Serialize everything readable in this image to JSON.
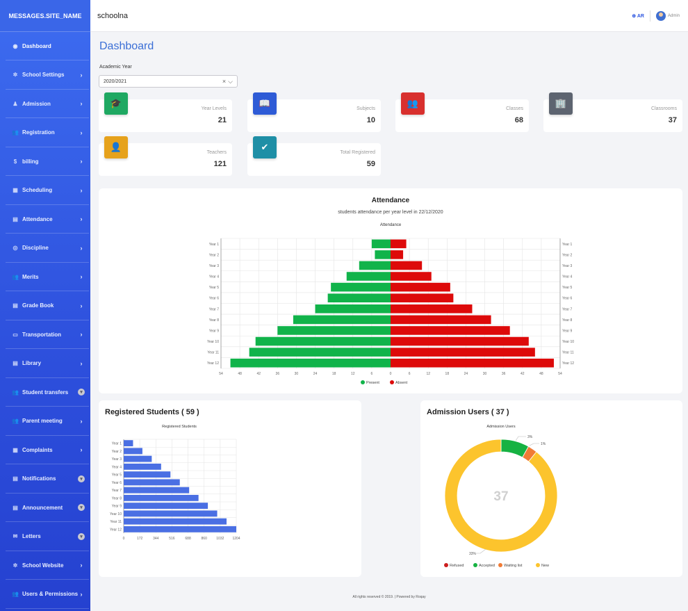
{
  "brand": "MESSAGES.SITE_NAME",
  "site_title": "schoolna",
  "header": {
    "lang": "AR",
    "user": "Admin"
  },
  "sidebar": {
    "items": [
      {
        "label": "Dashboard",
        "icon": "dashboard-icon",
        "chevron": "",
        "badge": "",
        "active": true
      },
      {
        "label": "School Settings",
        "icon": "gear-icon",
        "chevron": "›",
        "badge": ""
      },
      {
        "label": "Admission",
        "icon": "user-icon",
        "chevron": "›",
        "badge": ""
      },
      {
        "label": "Registration",
        "icon": "users-icon",
        "chevron": "›",
        "badge": ""
      },
      {
        "label": "billing",
        "icon": "dollar-icon",
        "chevron": "›",
        "badge": ""
      },
      {
        "label": "Scheduling",
        "icon": "table-icon",
        "chevron": "›",
        "badge": ""
      },
      {
        "label": "Attendance",
        "icon": "list-icon",
        "chevron": "›",
        "badge": ""
      },
      {
        "label": "Discipline",
        "icon": "target-icon",
        "chevron": "›",
        "badge": ""
      },
      {
        "label": "Merits",
        "icon": "users-icon",
        "chevron": "›",
        "badge": ""
      },
      {
        "label": "Grade Book",
        "icon": "book-icon",
        "chevron": "›",
        "badge": ""
      },
      {
        "label": "Transportation",
        "icon": "bus-icon",
        "chevron": "›",
        "badge": ""
      },
      {
        "label": "Library",
        "icon": "library-icon",
        "chevron": "›",
        "badge": ""
      },
      {
        "label": "Student transfers",
        "icon": "users-icon",
        "chevron": "",
        "badge": "▾"
      },
      {
        "label": "Parent meeting",
        "icon": "users-icon",
        "chevron": "›",
        "badge": ""
      },
      {
        "label": "Complaints",
        "icon": "table-icon",
        "chevron": "›",
        "badge": ""
      },
      {
        "label": "Notifications",
        "icon": "list-icon",
        "chevron": "",
        "badge": "▾"
      },
      {
        "label": "Announcement",
        "icon": "list-icon",
        "chevron": "",
        "badge": "▾"
      },
      {
        "label": "Letters",
        "icon": "mail-icon",
        "chevron": "",
        "badge": "▾"
      },
      {
        "label": "School Website",
        "icon": "gear-icon",
        "chevron": "›",
        "badge": ""
      },
      {
        "label": "Users & Permissions",
        "icon": "users-icon",
        "chevron": "›",
        "badge": ""
      }
    ]
  },
  "page": {
    "title": "Dashboard",
    "academic_year_label": "Academic Year",
    "academic_year_value": "2020/2021",
    "clear": "×",
    "chevron": "⌵"
  },
  "stats": [
    {
      "label": "Year Levels",
      "value": "21",
      "icon": "graduation-cap-icon",
      "color": "#1fa862",
      "glyph": "🎓"
    },
    {
      "label": "Subjects",
      "value": "10",
      "icon": "book-icon",
      "color": "#2e5bd6",
      "glyph": "📖"
    },
    {
      "label": "Classes",
      "value": "68",
      "icon": "users-icon",
      "color": "#d8302e",
      "glyph": "👥"
    },
    {
      "label": "Classrooms",
      "value": "37",
      "icon": "building-icon",
      "color": "#5d6470",
      "glyph": "🏢"
    },
    {
      "label": "Teachers",
      "value": "121",
      "icon": "teacher-icon",
      "color": "#e6a21c",
      "glyph": "👤"
    },
    {
      "label": "Total Registered",
      "value": "59",
      "icon": "user-check-icon",
      "color": "#1f8fa6",
      "glyph": "✔"
    }
  ],
  "attendance": {
    "title": "Attendance",
    "subtitle": "students attendance per year level in 22/12/2020",
    "chart_title": "Attendance",
    "legend": [
      {
        "name": "Present",
        "color": "#11b34a"
      },
      {
        "name": "Absent",
        "color": "#dd0a0a"
      }
    ]
  },
  "registered": {
    "title": "Registered Students ( 59 )",
    "chart_title": "Registered Students"
  },
  "admission": {
    "title": "Admission Users ( 37 )",
    "chart_title": "Admission Users",
    "center": "37",
    "labels": [
      "3%",
      "1%",
      "33%"
    ],
    "legend": [
      {
        "name": "Refused",
        "color": "#cc1e1e"
      },
      {
        "name": "Accepted",
        "color": "#16b242"
      },
      {
        "name": "Waiting list",
        "color": "#f07b35"
      },
      {
        "name": "New",
        "color": "#fcc42d"
      }
    ]
  },
  "footer": "All rights reserved © 2019. | Powered by Roqay",
  "chart_data": [
    {
      "type": "bar",
      "orientation": "horizontal",
      "title": "Attendance",
      "categories": [
        "Year 1",
        "Year 2",
        "Year 3",
        "Year 4",
        "Year 5",
        "Year 6",
        "Year 7",
        "Year 8",
        "Year 9",
        "Year 10",
        "Year 11",
        "Year 12"
      ],
      "series": [
        {
          "name": "Present",
          "color": "#11b34a",
          "values": [
            6,
            5,
            10,
            14,
            19,
            20,
            24,
            31,
            36,
            43,
            45,
            51
          ]
        },
        {
          "name": "Absent",
          "color": "#dd0a0a",
          "values": [
            5,
            4,
            10,
            13,
            19,
            20,
            26,
            32,
            38,
            44,
            46,
            52
          ]
        }
      ],
      "xlim": [
        -54,
        54
      ],
      "xticks": [
        "54",
        "48",
        "42",
        "36",
        "30",
        "24",
        "18",
        "12",
        "6",
        "0",
        "6",
        "12",
        "18",
        "24",
        "30",
        "36",
        "42",
        "48",
        "54"
      ],
      "grid": true,
      "legend": "bottom"
    },
    {
      "type": "bar",
      "orientation": "horizontal",
      "title": "Registered Students",
      "categories": [
        "Year 1",
        "Year 2",
        "Year 3",
        "Year 4",
        "Year 5",
        "Year 6",
        "Year 7",
        "Year 8",
        "Year 9",
        "Year 10",
        "Year 11",
        "Year 12"
      ],
      "series": [
        {
          "name": "",
          "color": "#4a6fe3",
          "values": [
            100,
            200,
            300,
            400,
            500,
            600,
            700,
            800,
            900,
            1000,
            1100,
            1204
          ]
        }
      ],
      "xlim": [
        0,
        1204
      ],
      "xticks": [
        "0",
        "172",
        "344",
        "516",
        "688",
        "860",
        "1032",
        "1204"
      ],
      "grid": true
    },
    {
      "type": "pie",
      "title": "Admission Users",
      "categories": [
        "Refused",
        "Accepted",
        "Waiting list",
        "New"
      ],
      "values": [
        0,
        3,
        1,
        33
      ],
      "colors": [
        "#cc1e1e",
        "#16b242",
        "#f07b35",
        "#fcc42d"
      ],
      "legend": "bottom"
    }
  ]
}
